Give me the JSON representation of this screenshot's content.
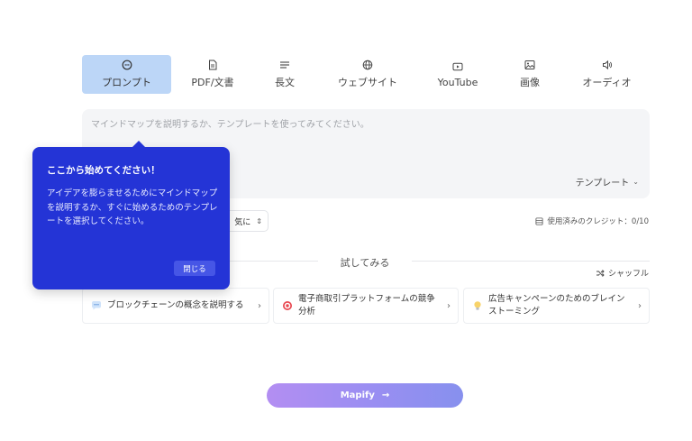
{
  "tabs": [
    {
      "label": "プロンプト",
      "icon": "chat-bubble-icon",
      "active": true
    },
    {
      "label": "PDF/文書",
      "icon": "document-icon",
      "active": false
    },
    {
      "label": "長文",
      "icon": "text-lines-icon",
      "active": false
    },
    {
      "label": "ウェブサイト",
      "icon": "globe-icon",
      "active": false
    },
    {
      "label": "YouTube",
      "icon": "play-icon",
      "active": false
    },
    {
      "label": "画像",
      "icon": "image-icon",
      "active": false
    },
    {
      "label": "オーディオ",
      "icon": "speaker-icon",
      "active": false
    }
  ],
  "prompt": {
    "placeholder": "マインドマップを説明するか、テンプレートを使ってみてください。",
    "value": "",
    "template_label": "テンプレート"
  },
  "options": {
    "mode_label": "気に",
    "credits_label": "使用済みのクレジット：0/10"
  },
  "try_section": {
    "title": "試してみる",
    "shuffle_label": "シャッフル",
    "suggestions": [
      {
        "icon": "speech-bubble-icon",
        "text": "ブロックチェーンの概念を説明する"
      },
      {
        "icon": "target-icon",
        "text": "電子商取引プラットフォームの競争分析"
      },
      {
        "icon": "lightbulb-icon",
        "text": "広告キャンペーンのためのブレインストーミング"
      }
    ]
  },
  "mapify_label": "Mapify",
  "popover": {
    "title": "ここから始めてください！",
    "body": "アイデアを膨らませるためにマインドマップを説明するか、すぐに始めるためのテンプレートを選択してください。",
    "close_label": "閉じる"
  },
  "colors": {
    "tab_active_bg": "#bcd6f7",
    "popover_bg": "#2434d6",
    "button_gradient_start": "#b38ef2",
    "button_gradient_end": "#8790ee"
  }
}
